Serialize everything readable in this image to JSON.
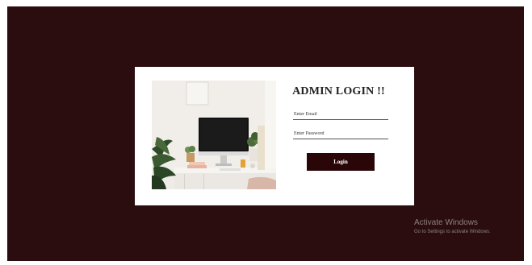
{
  "login": {
    "title": "ADMIN LOGIN !!",
    "email_placeholder": "Enter Email",
    "email_value": "",
    "password_placeholder": "Enter Password",
    "password_value": "",
    "button_label": "Login"
  },
  "watermark": {
    "title": "Activate Windows",
    "subtitle": "Go to Settings to activate Windows."
  },
  "colors": {
    "page_background": "#2b0d0f",
    "card_background": "#ffffff",
    "button_background": "#2b0609",
    "button_text": "#ffffff"
  },
  "illustration": {
    "subject": "desk-workspace-photo"
  }
}
